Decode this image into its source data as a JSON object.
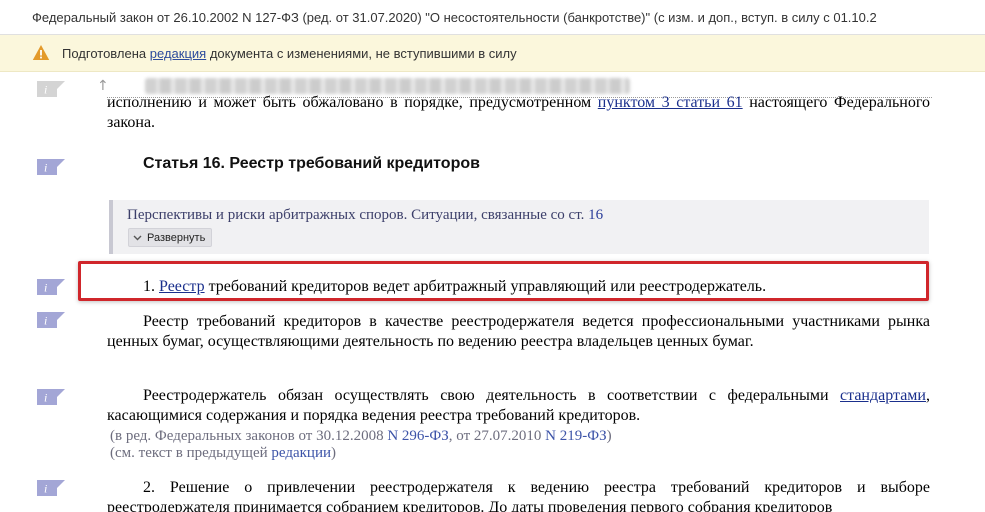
{
  "title_bar": {
    "text": "Федеральный закон от 26.10.2002 N 127-ФЗ (ред. от 31.07.2020) \"О несостоятельности (банкротстве)\" (с изм. и доп., вступ. в силу с 01.10.2"
  },
  "notice": {
    "prefix": "Подготовлена ",
    "link": "редакция",
    "suffix": " документа с изменениями, не вступившими в силу"
  },
  "document": {
    "cut_paragraph": {
      "text_before": "исполнению и может быть обжаловано в порядке, предусмотренном ",
      "link": "пунктом 3 статьи 61",
      "text_after": " настоящего Федерального закона."
    },
    "article_title": "Статья 16. Реестр требований кредиторов",
    "practice_box": {
      "text": "Перспективы и риски арбитражных споров. Ситуации, связанные со ст. ",
      "article_number": "16",
      "expand_label": "Развернуть"
    },
    "clause1": {
      "number": "1. ",
      "link": "Реестр",
      "text": " требований кредиторов ведет арбитражный управляющий или реестродержатель."
    },
    "para2": "Реестр требований кредиторов в качестве реестродержателя ведется профессиональными участниками рынка ценных бумаг, осуществляющими деятельность по ведению реестра владельцев ценных бумаг.",
    "para3": {
      "text_before": "Реестродержатель обязан осуществлять свою деятельность в соответствии с федеральными ",
      "link": "стандартами",
      "text_after": ", касающимися содержания и порядка ведения реестра требований кредиторов."
    },
    "edition_note1": {
      "prefix": "(в ред. Федеральных законов от 30.12.2008 ",
      "link1": "N 296-ФЗ",
      "middle": ", от 27.07.2010 ",
      "link2": "N 219-ФЗ",
      "suffix": ")"
    },
    "edition_note2": {
      "prefix": "(см. текст в предыдущей ",
      "link": "редакции",
      "suffix": ")"
    },
    "clause2": "2. Решение о привлечении реестродержателя к ведению реестра требований кредиторов и выборе реестродержателя принимается собранием кредиторов. До даты проведения первого собрания кредиторов"
  },
  "colors": {
    "info_flag": "#a3a6d6",
    "highlight_frame": "#d0262b",
    "notice_bg": "#fbf7dc",
    "link": "#1a2f8c"
  },
  "icons": [
    "warning-icon",
    "info-flag-icon",
    "up-arrow-icon",
    "chevron-down-icon"
  ]
}
